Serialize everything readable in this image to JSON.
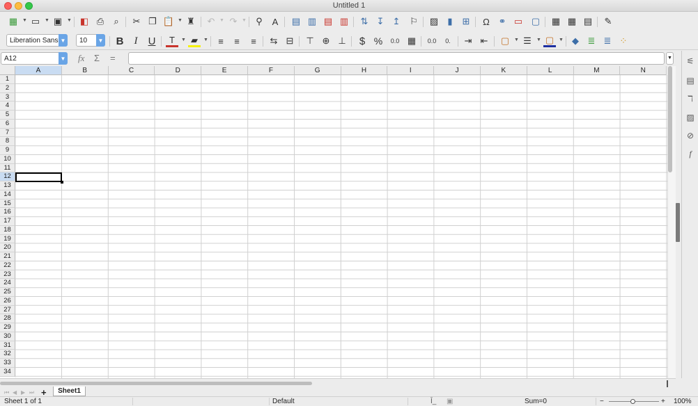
{
  "window": {
    "title": "Untitled 1"
  },
  "toolbar1": {
    "icons": [
      "table-icon",
      "open-folder-icon",
      "save-icon",
      "export-pdf-icon",
      "print-icon",
      "print-preview-icon",
      "cut-icon",
      "copy-icon",
      "paste-icon",
      "clone-format-icon",
      "undo-icon",
      "redo-icon",
      "find-replace-icon",
      "spelling-icon",
      "row-icon",
      "column-icon",
      "insert-rows-icon",
      "insert-columns-icon",
      "sort-icon",
      "sort-ascending-icon",
      "sort-descending-icon",
      "autofilter-icon",
      "image-icon",
      "chart-icon",
      "pivot-table-icon",
      "special-character-icon",
      "hyperlink-icon",
      "comment-icon",
      "headers-footers-icon",
      "define-print-area-icon",
      "freeze-rows-icon",
      "split-window-icon",
      "show-draw-functions-icon"
    ]
  },
  "toolbar2": {
    "font_name": "Liberation Sans",
    "font_size": "10",
    "bold": "B",
    "italic": "I",
    "underline": "U",
    "currency": "$",
    "percent": "%",
    "number_format": "0.0",
    "add_decimal": "0.0",
    "delete_decimal": "0.",
    "font_color": "#c8342c",
    "highlight_color": "#f5f20a",
    "border_color": "#1e2fa0"
  },
  "formula_bar": {
    "name_box": "A12",
    "function_wizard": "fx",
    "sum": "Σ",
    "function": "=",
    "input_value": ""
  },
  "grid": {
    "columns": [
      "A",
      "B",
      "C",
      "D",
      "E",
      "F",
      "G",
      "H",
      "I",
      "J",
      "K",
      "L",
      "M",
      "N"
    ],
    "rows": [
      "1",
      "2",
      "3",
      "4",
      "5",
      "6",
      "7",
      "8",
      "9",
      "10",
      "11",
      "12",
      "13",
      "14",
      "15",
      "16",
      "17",
      "18",
      "19",
      "20",
      "21",
      "22",
      "23",
      "24",
      "25",
      "26",
      "27",
      "28",
      "29",
      "30",
      "31",
      "32",
      "33",
      "34"
    ],
    "selected_cell": "A12"
  },
  "sheets": {
    "add": "+",
    "tabs": [
      "Sheet1"
    ]
  },
  "status": {
    "sheet_info": "Sheet 1 of 1",
    "page_style": "Default",
    "sum": "Sum=0",
    "zoom_minus": "−",
    "zoom_plus": "+",
    "zoom": "100%"
  },
  "sidebar": {
    "icons": [
      "properties-icon",
      "styles-icon",
      "gallery-icon",
      "navigator-icon",
      "functions-icon"
    ]
  }
}
